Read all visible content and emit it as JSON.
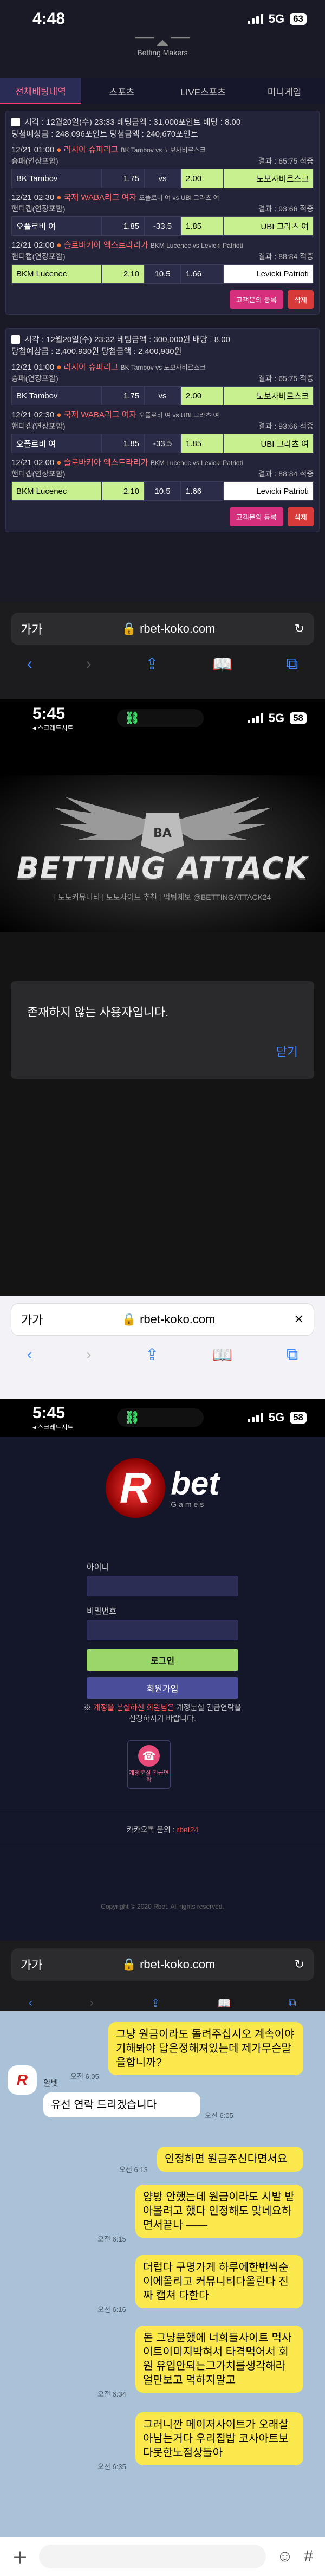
{
  "s1": {
    "time": "4:48",
    "network": "5G",
    "battery": "63",
    "site_logo": "Betting Makers",
    "tabs": [
      "전체베팅내역",
      "스포츠",
      "LIVE스포츠",
      "미니게임"
    ],
    "cards": [
      {
        "head1": "시각 : 12월20일(수) 23:33  베팅금액 : 31,000포인트  배당 : 8.00",
        "head2": "당첨예상금 : 248,096포인트  당첨금액 : 240,670포인트",
        "matches": [
          {
            "time": "12/21 01:00",
            "league": "러시아 슈퍼리그",
            "vs": "BK Tambov vs 노보사비르스크",
            "type": "승패(연장포함)",
            "result": "결과 : 65:75 적중",
            "home": "BK Tambov",
            "ho": "1.75",
            "mid": "vs",
            "ao": "2.00",
            "away": "노보사비르스크",
            "sel": "away"
          },
          {
            "time": "12/21 02:30",
            "league": "국제 WABA리그 여자",
            "vs": "오플로비 여 vs UBI 그라츠 여",
            "type": "핸디캡(연장포함)",
            "result": "결과 : 93:66 적중",
            "home": "오플로비 여",
            "ho": "1.85",
            "mid": "-33.5",
            "ao": "1.85",
            "away": "UBI 그라츠 여",
            "sel": "away"
          },
          {
            "time": "12/21 02:00",
            "league": "슬로바키아 엑스트라리가",
            "vs": "BKM Lucenec vs Levicki Patrioti",
            "type": "핸디캡(연장포함)",
            "result": "결과 : 88:84 적중",
            "home": "BKM Lucenec",
            "ho": "2.10",
            "mid": "10.5",
            "ao": "1.66",
            "away": "Levicki Patrioti",
            "sel": "home"
          }
        ]
      },
      {
        "head1": "시각 : 12월20일(수) 23:32  베팅금액 : 300,000원  배당 : 8.00",
        "head2": "당첨예상금 : 2,400,930원  당첨금액 : 2,400,930원",
        "matches": [
          {
            "time": "12/21 01:00",
            "league": "러시아 슈퍼리그",
            "vs": "BK Tambov vs 노보사비르스크",
            "type": "승패(연장포함)",
            "result": "결과 : 65:75 적중",
            "home": "BK Tambov",
            "ho": "1.75",
            "mid": "vs",
            "ao": "2.00",
            "away": "노보사비르스크",
            "sel": "away"
          },
          {
            "time": "12/21 02:30",
            "league": "국제 WABA리그 여자",
            "vs": "오플로비 여 vs UBI 그라츠 여",
            "type": "핸디캡(연장포함)",
            "result": "결과 : 93:66 적중",
            "home": "오플로비 여",
            "ho": "1.85",
            "mid": "-33.5",
            "ao": "1.85",
            "away": "UBI 그라츠 여",
            "sel": "away"
          },
          {
            "time": "12/21 02:00",
            "league": "슬로바키아 엑스트라리가",
            "vs": "BKM Lucenec vs Levicki Patrioti",
            "type": "핸디캡(연장포함)",
            "result": "결과 : 88:84 적중",
            "home": "BKM Lucenec",
            "ho": "2.10",
            "mid": "10.5",
            "ao": "1.66",
            "away": "Levicki Patrioti",
            "sel": "home"
          }
        ]
      }
    ],
    "btn_board": "고객문의 등록",
    "btn_delete": "삭제",
    "url": "rbet-koko.com",
    "aa": "가가"
  },
  "s2": {
    "time": "5:45",
    "back": "◂ 스크레드시트",
    "network": "5G",
    "battery": "58",
    "banner_title": "BETTING ATTACK",
    "banner_sub": "| 토토커뮤니티 | 토토사이트 추천 | 먹튀제보 @BETTINGATTACK24",
    "dialog_msg": "존재하지 않는 사용자입니다.",
    "dialog_close": "닫기",
    "url": "rbet-koko.com",
    "aa": "가가"
  },
  "s3": {
    "time": "5:45",
    "back": "◂ 스크레드시트",
    "network": "5G",
    "battery": "58",
    "logo_main": "bet",
    "logo_sub": "Games",
    "label_id": "아이디",
    "label_pw": "비밀번호",
    "btn_login": "로그인",
    "btn_join": "회원가입",
    "notice_prefix": "※ ",
    "notice_red": "계정을 분실하신 회원님은",
    "notice_rest": " 계정분실 긴급연락을 신청하시기 바랍니다.",
    "cs_label": "계정분실 긴급연락",
    "kakao": "카카오톡 문의 : ",
    "kakao_id": "rbet24",
    "copyright": "Copyright © 2020 Rbet. All rights reserved.",
    "url": "rbet-koko.com",
    "aa": "가가"
  },
  "s4": {
    "sender": "알벳",
    "messages": [
      {
        "from": "me",
        "text": "그냥 원금이라도 돌려주십시오 계속이야기해봐야 답은정해져있는데 제가무슨말을합니까?",
        "time": "오전 6:05"
      },
      {
        "from": "them",
        "text": "유선 연락 드리겠습니다",
        "time": "오전 6:05"
      },
      {
        "from": "me",
        "text": "인정하면 원금주신다면서요",
        "time": "오전 6:13"
      },
      {
        "from": "me",
        "text": "양방 안했는데 원금이라도 시발 받아볼려고 했다 인정해도 맞네요하면서끝나 ——",
        "time": "오전 6:15"
      },
      {
        "from": "me",
        "text": "더럽다 구명가게 하루에한번씩순이에올리고 커뮤니티다올린다 진짜 캡쳐 다한다",
        "time": "오전 6:16"
      },
      {
        "from": "me",
        "text": "돈 그냥문했에 너희들사이트 먹사이트이미지박혀서 타격먹어서 회원 유입안되는그가치를생각해라 얼만보고 먹하지말고",
        "time": "오전 6:34"
      },
      {
        "from": "me",
        "text": "그러니깐 메이저사이트가 오래살아남는거다 우리집밥 코사아트보다못한노점상들아",
        "time": "오전 6:35"
      }
    ]
  }
}
